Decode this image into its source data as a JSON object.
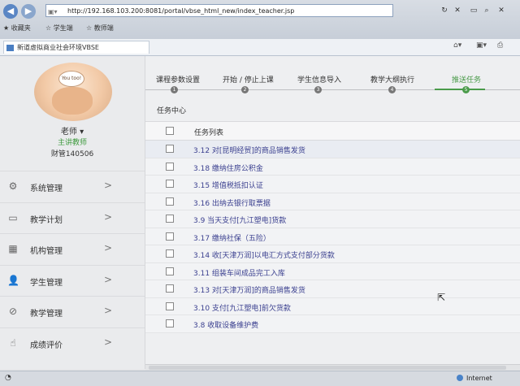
{
  "browser": {
    "url": "http://192.168.103.200:8081/portal/vbse_html_new/index_teacher.jsp",
    "favorites": [
      "收藏夹",
      "学生端",
      "教师端"
    ],
    "tab_title": "新道虚拟商业社会环境VBSE",
    "status_zone": "Internet"
  },
  "sidebar": {
    "avatar_text": "You too!",
    "teacher_label": "老师 ▾",
    "role": "主讲教师",
    "account": "财管140506",
    "items": [
      {
        "label": "系统管理",
        "icon": "⚙"
      },
      {
        "label": "教学计划",
        "icon": "▭"
      },
      {
        "label": "机构管理",
        "icon": "▦"
      },
      {
        "label": "学生管理",
        "icon": "👤"
      },
      {
        "label": "教学管理",
        "icon": "⊘"
      },
      {
        "label": "成绩评价",
        "icon": "☝"
      }
    ]
  },
  "steps": [
    {
      "label": "课程参数设置",
      "num": "1"
    },
    {
      "label": "开始 / 停止上课",
      "num": "2"
    },
    {
      "label": "学生信息导入",
      "num": "3"
    },
    {
      "label": "教学大纲执行",
      "num": "4"
    },
    {
      "label": "推送任务",
      "num": "5",
      "active": true
    }
  ],
  "task_center": "任务中心",
  "table": {
    "header": "任务列表",
    "rows": [
      "3.12 对[昆明经贸]的商品销售发货",
      "3.18 缴纳住房公积金",
      "3.15 增值税抵扣认证",
      "3.16 出纳去银行取票据",
      "3.9 当天支付[九江塑电]货款",
      "3.17 缴纳社保（五险）",
      "3.14 收[天津万润]以电汇方式支付部分货款",
      "3.11 组装车间成品完工入库",
      "3.13 对[天津万润]的商品销售发货",
      "3.10 支付[九江塑电]前欠货款",
      "3.8 收取设备维护费"
    ]
  },
  "colors": {
    "accent": "#4a9b4a",
    "link": "#3a3f8f"
  }
}
